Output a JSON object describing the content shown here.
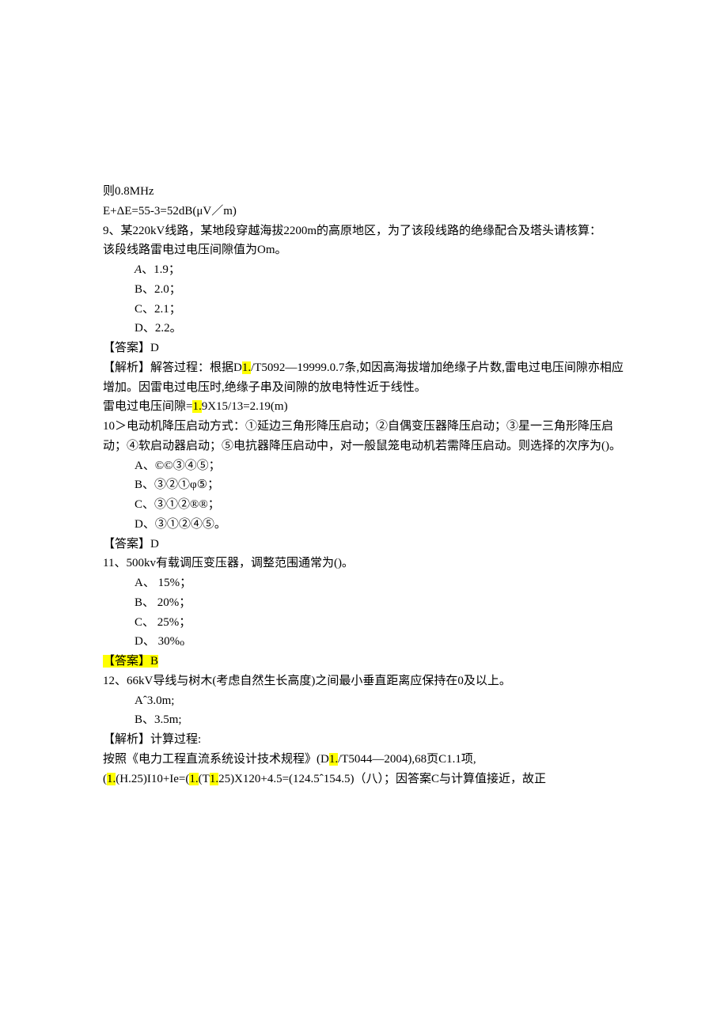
{
  "lines": {
    "l1": "则0.8MHz",
    "l2": "E+ΔE=55-3=52dB(μV／m)",
    "l3": "9、某220kV线路，某地段穿越海拔2200m的高原地区，为了该段线路的绝缘配合及塔头请核算：",
    "l4": "该段线路雷电过电压间隙值为Om。",
    "l5": "A、1.9；",
    "l6": "B、2.0；",
    "l7": "C、2.1；",
    "l8": "D、2.2。",
    "l9": "【答案】D",
    "l10a": "【解析】解答过程：根据D",
    "l10b": "1.",
    "l10c": "/T5092—19999.0.7条,如因高海拔增加绝缘子片数,雷电过电压间隙亦相应增加。因雷电过电压时,绝缘子串及间隙的放电特性近于线性。",
    "l11a": "雷电过电压间隙=",
    "l11b": "1.",
    "l11c": "9X15/13=2.19(m)",
    "l12": "10＞电动机降压启动方式：①延边三角形降压启动；②自偶变压器降压启动；③星一三角形降压启动；④软启动器启动；⑤电抗器降压启动中，对一般鼠笼电动机若需降压启动。则选择的次序为()。",
    "l13": "A、©©③④⑤；",
    "l14": "B、③②①φ⑤；",
    "l15": "C、③①②®®；",
    "l16": "D、③①②④⑤。",
    "l17": "【答案】D",
    "l18": "11、500kv有载调压变压器，调整范围通常为()。",
    "l19": "A、 15%；",
    "l20": "B、 20%；",
    "l21": "C、 25%；",
    "l22": "D、 30%",
    "l22s": "o",
    "l23": "【答案】B",
    "l24": "12、66kV导线与树木(考虑自然生长高度)之间最小垂直距离应保持在0及以上。",
    "l25": "Aˆ3.0m;",
    "l26": "B、3.5m;",
    "l27": "【解析】计算过程:",
    "l28a": "按照《电力工程直流系统设计技术规程》(D",
    "l28b": "1.",
    "l28c": "/T5044—2004),68页C1.1项,",
    "l29a": "(",
    "l29b": "1.",
    "l29c": "(H.25)I10+Ie=(",
    "l29d": "1.",
    "l29e": "(T",
    "l29f": "1.",
    "l29g": "25)X120+4.5=(124.5ˆ154.5)（八）；因答案C与计算值接近，故正"
  }
}
